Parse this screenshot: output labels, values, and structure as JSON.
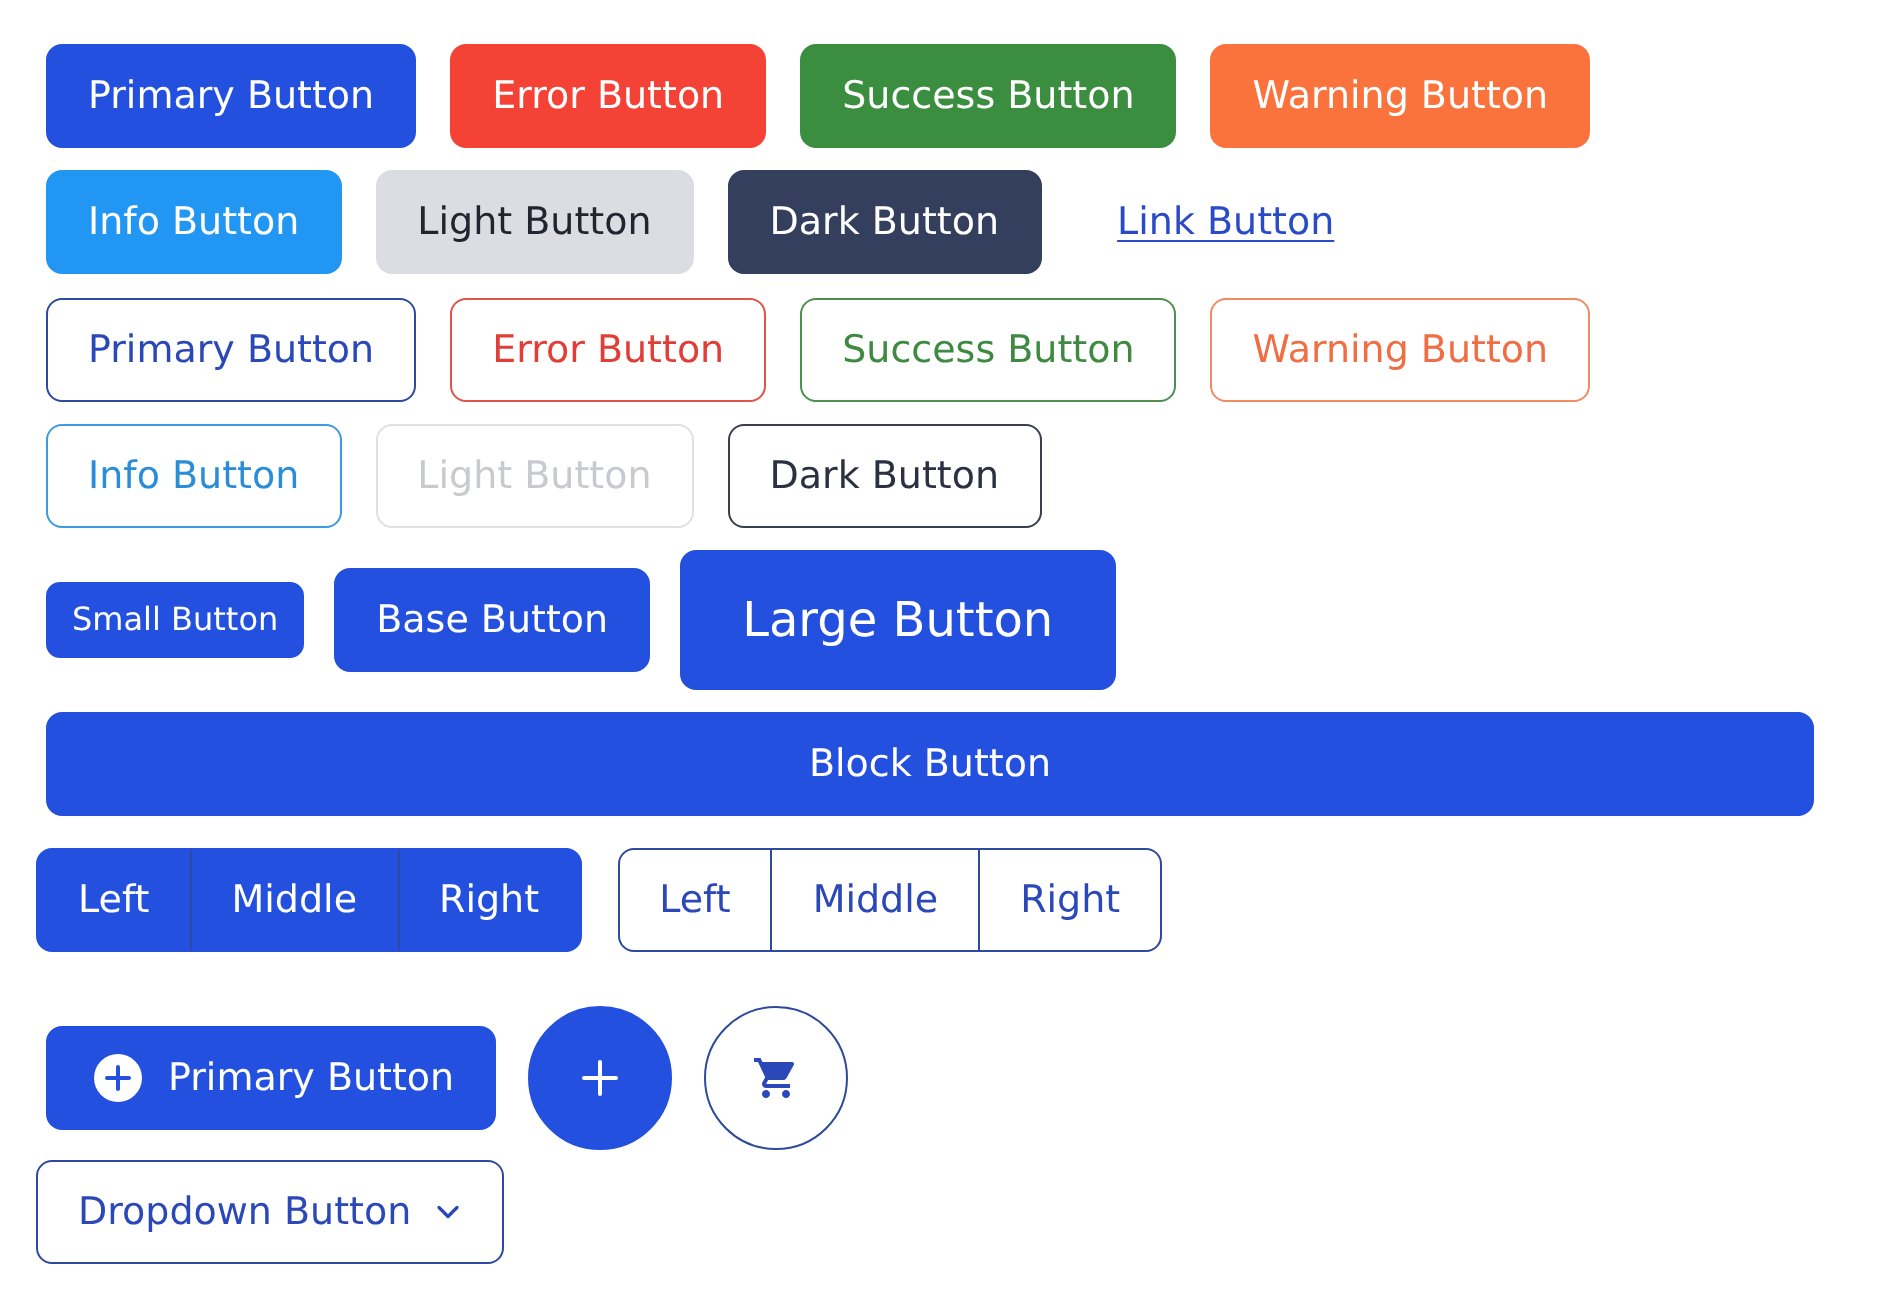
{
  "solid_buttons": [
    {
      "kind": "primary",
      "label": "Primary Button"
    },
    {
      "kind": "error",
      "label": "Error Button"
    },
    {
      "kind": "success",
      "label": "Success Button"
    },
    {
      "kind": "warning",
      "label": "Warning Button"
    },
    {
      "kind": "info",
      "label": "Info Button"
    },
    {
      "kind": "light",
      "label": "Light Button"
    },
    {
      "kind": "dark",
      "label": "Dark Button"
    },
    {
      "kind": "link",
      "label": "Link Button"
    }
  ],
  "outline_buttons": [
    {
      "kind": "primary",
      "label": "Primary Button"
    },
    {
      "kind": "error",
      "label": "Error Button"
    },
    {
      "kind": "success",
      "label": "Success Button"
    },
    {
      "kind": "warning",
      "label": "Warning Button"
    },
    {
      "kind": "info",
      "label": "Info Button"
    },
    {
      "kind": "light",
      "label": "Light Button"
    },
    {
      "kind": "dark",
      "label": "Dark Button"
    }
  ],
  "size_buttons": [
    {
      "kind": "small",
      "label": "Small Button"
    },
    {
      "kind": "base",
      "label": "Base Button"
    },
    {
      "kind": "large",
      "label": "Large Button"
    }
  ],
  "block_button": {
    "label": "Block Button"
  },
  "button_groups": [
    {
      "kind": "solid",
      "items": [
        "Left",
        "Middle",
        "Right"
      ]
    },
    {
      "kind": "outline",
      "items": [
        "Left",
        "Middle",
        "Right"
      ]
    }
  ],
  "icon_buttons": [
    {
      "kind": "labeled",
      "label": "Primary Button"
    },
    {
      "kind": "fab"
    },
    {
      "kind": "circle"
    }
  ],
  "dropdown_button": {
    "label": "Dropdown Button"
  }
}
